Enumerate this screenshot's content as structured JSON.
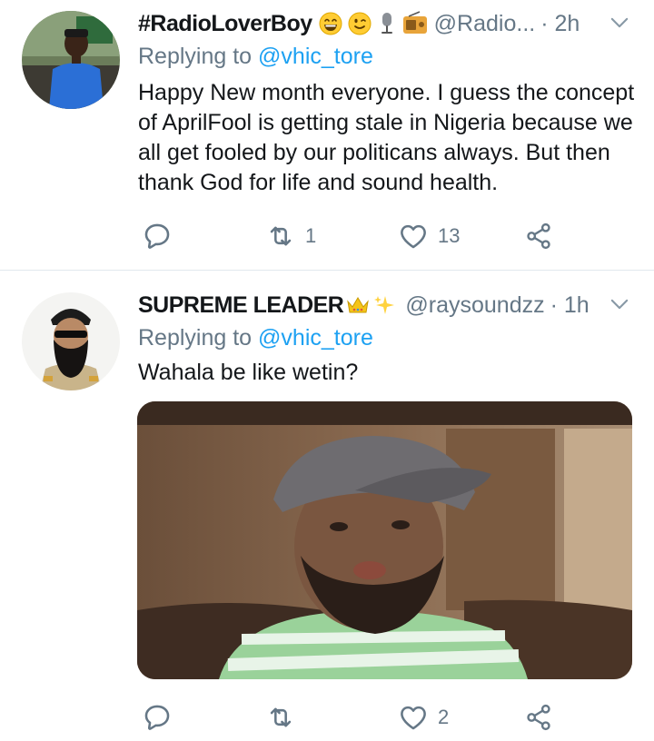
{
  "tweets": [
    {
      "display_name": "#RadioLoverBoy",
      "emojis": [
        "grinning-face",
        "winking-face",
        "microphone",
        "radio"
      ],
      "handle": "@Radio...",
      "time": "· 2h",
      "replying_prefix": "Replying to ",
      "replying_to": "@vhic_tore",
      "text": "Happy New month everyone. I guess the concept of AprilFool is getting stale in Nigeria because we all get fooled by our politicans always. But then thank God for life and sound health.",
      "replies": "",
      "retweets": "1",
      "likes": "13"
    },
    {
      "display_name": "SUPREME LEADER",
      "emojis": [
        "crown",
        "sparkles"
      ],
      "handle": "@raysoundzz",
      "time": "· 1h",
      "replying_prefix": "Replying to ",
      "replying_to": "@vhic_tore",
      "text": "Wahala be like wetin?",
      "replies": "",
      "retweets": "",
      "likes": "2"
    }
  ],
  "icons": {
    "reply": "reply-icon",
    "retweet": "retweet-icon",
    "like": "heart-icon",
    "share": "share-icon",
    "caret": "chevron-down-icon"
  },
  "colors": {
    "text": "#14171a",
    "muted": "#657786",
    "link": "#1da1f2",
    "divider": "#e1e8ed"
  }
}
